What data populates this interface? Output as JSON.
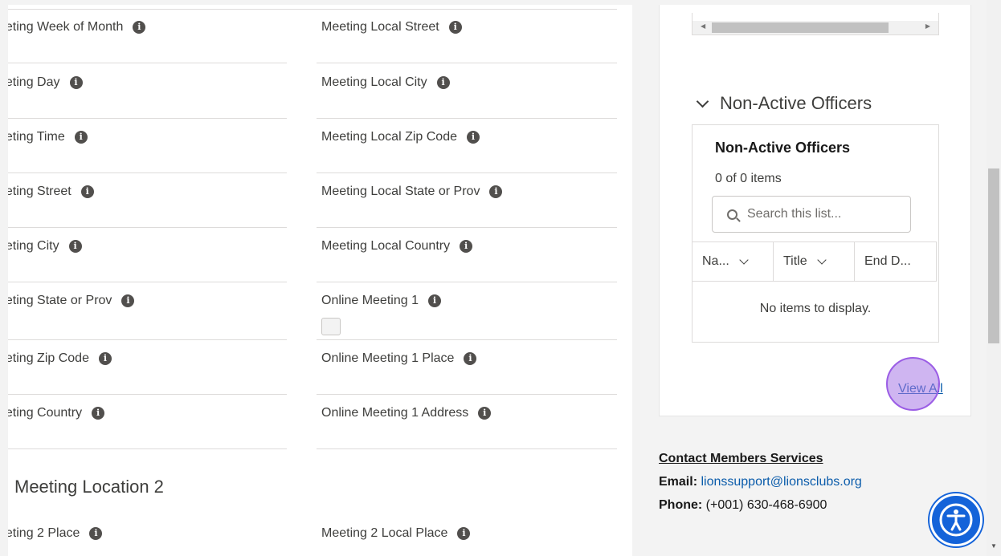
{
  "fields_left": [
    {
      "label": "eeting Week of Month"
    },
    {
      "label": "eeting Day"
    },
    {
      "label": "eeting Time"
    },
    {
      "label": "eeting Street"
    },
    {
      "label": "eeting City"
    },
    {
      "label": "eeting State or Prov"
    },
    {
      "label": "eeting Zip Code"
    },
    {
      "label": "eeting Country"
    }
  ],
  "fields_right": [
    {
      "label": "Meeting Local Street"
    },
    {
      "label": "Meeting Local City"
    },
    {
      "label": "Meeting Local Zip Code"
    },
    {
      "label": "Meeting Local State or Prov"
    },
    {
      "label": "Meeting Local Country"
    },
    {
      "label": "Online Meeting 1"
    },
    {
      "label": "Online Meeting 1 Place"
    },
    {
      "label": "Online Meeting 1 Address"
    }
  ],
  "section2": {
    "title": "Meeting Location 2",
    "left_label": "eeting 2 Place",
    "right_label": "Meeting 2 Local Place"
  },
  "info_glyph": "i",
  "officers": {
    "accordion_label": "Non-Active Officers",
    "list_title": "Non-Active Officers",
    "count": "0 of 0 items",
    "search_placeholder": "Search this list...",
    "columns": [
      "Na...",
      "Title",
      "End D..."
    ],
    "empty_text": "No items to display.",
    "view_all": "View All"
  },
  "contact": {
    "heading": "Contact Members Services",
    "email_label": "Email:",
    "email": "lionssupport@lionsclubs.org",
    "phone_label": "Phone:",
    "phone": "(+001) 630-468-6900"
  },
  "colors": {
    "link": "#0b5cab",
    "accessibility_button": "#1463d9",
    "highlight": "#9b5de5"
  }
}
